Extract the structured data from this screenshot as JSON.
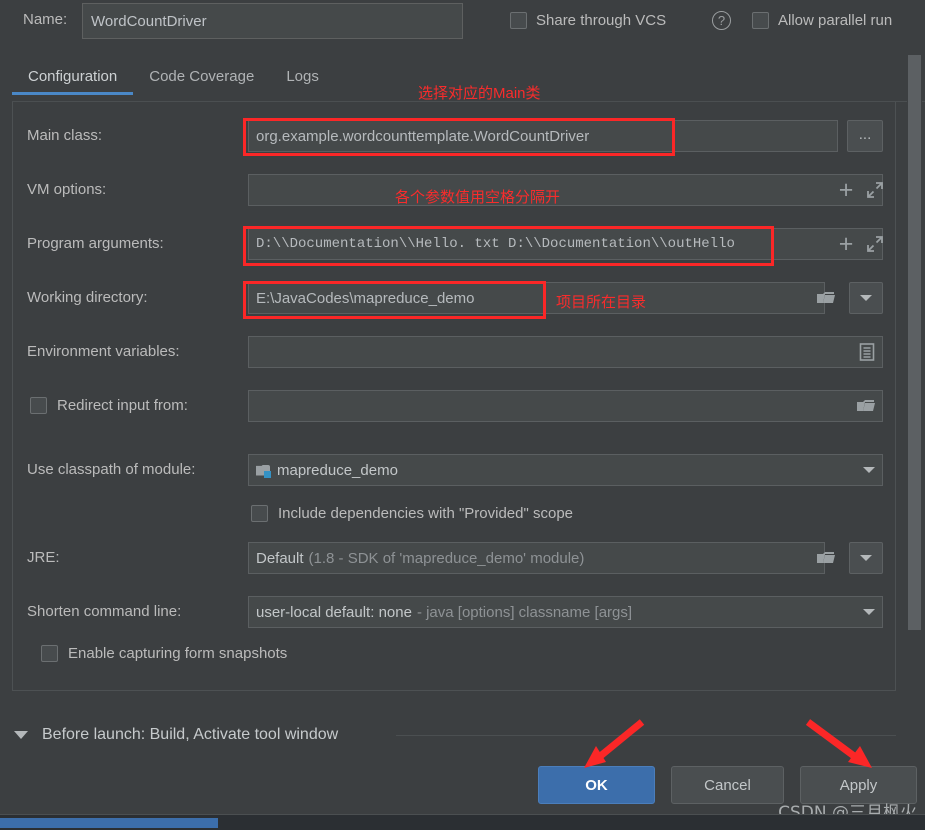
{
  "window": {
    "theme_bg": "#3c3f41",
    "accent": "#4a88c7",
    "annotation_color": "#f82c2c"
  },
  "name_row": {
    "label": "Name:",
    "value": "WordCountDriver",
    "placeholder": "Name",
    "share_through_vcs": {
      "label": "Share through VCS",
      "checked": false
    },
    "help_icon": "?",
    "allow_parallel_run": {
      "label": "Allow parallel run",
      "checked": false
    }
  },
  "tabs": [
    {
      "label": "Configuration",
      "active": true
    },
    {
      "label": "Code Coverage",
      "active": false
    },
    {
      "label": "Logs",
      "active": false
    }
  ],
  "fields": {
    "main_class": {
      "label": "Main class:",
      "value": "org.example.wordcounttemplate.WordCountDriver",
      "browse_button": "...",
      "highlighted": true
    },
    "vm_options": {
      "label": "VM options:",
      "value": "",
      "add_icon": "plus-icon",
      "expand_icon": "expand-icon"
    },
    "program_arguments": {
      "label": "Program arguments:",
      "value": "D:\\\\Documentation\\\\Hello. txt D:\\\\Documentation\\\\outHello",
      "add_icon": "plus-icon",
      "expand_icon": "expand-icon",
      "highlighted": true
    },
    "working_directory": {
      "label": "Working directory:",
      "value": "E:\\JavaCodes\\mapreduce_demo",
      "highlighted": true
    },
    "environment_variables": {
      "label": "Environment variables:",
      "value": ""
    },
    "redirect_input_from": {
      "label": "Redirect input from:",
      "checked": false,
      "value": ""
    },
    "use_classpath_of_module": {
      "label": "Use classpath of module:",
      "value": "mapreduce_demo"
    },
    "include_provided_scope": {
      "label": "Include dependencies with \"Provided\" scope",
      "checked": false
    },
    "jre": {
      "label": "JRE:",
      "value": "Default",
      "value_detail": "(1.8 - SDK of 'mapreduce_demo' module)"
    },
    "shorten_command_line": {
      "label": "Shorten command line:",
      "value": "user-local default: none",
      "value_detail": "- java [options] classname [args]"
    },
    "enable_form_snapshots": {
      "label": "Enable capturing form snapshots",
      "checked": false
    }
  },
  "annotations": [
    {
      "text": "选择对应的Main类"
    },
    {
      "text": "各个参数值用空格分隔开"
    },
    {
      "text": "项目所在目录"
    }
  ],
  "before_launch": {
    "label": "Before launch: Build, Activate tool window",
    "expanded": true
  },
  "footer": {
    "ok": "OK",
    "cancel": "Cancel",
    "apply": "Apply"
  },
  "watermark": "CSDN @三月枫火"
}
